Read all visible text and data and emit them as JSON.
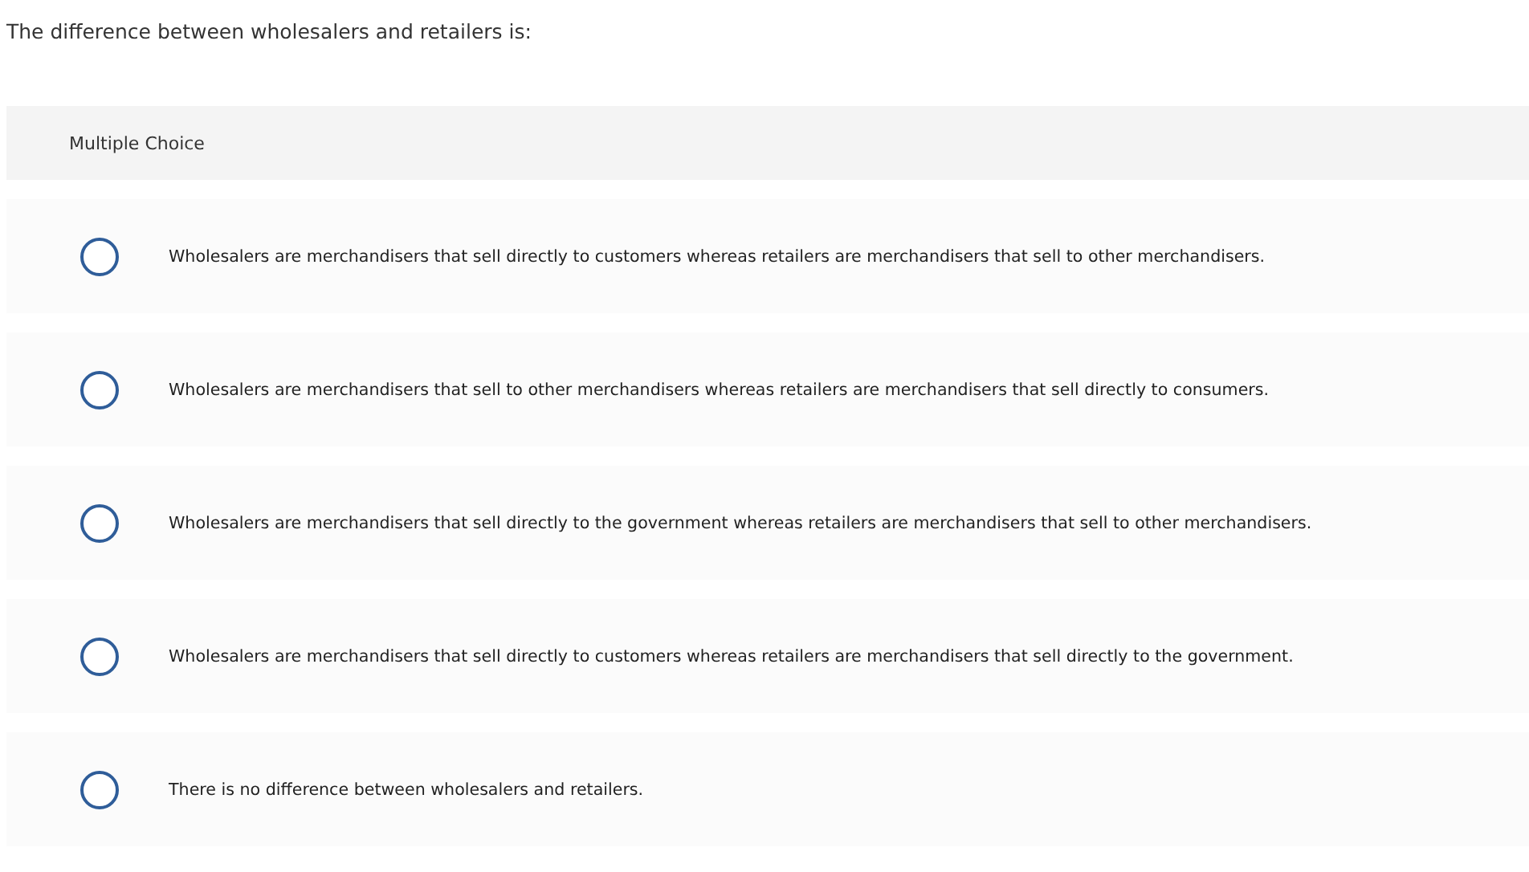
{
  "question": "The difference between wholesalers and retailers is:",
  "panel": {
    "header": "Multiple Choice"
  },
  "options": [
    {
      "label": "Wholesalers are merchandisers that sell directly to customers whereas retailers are merchandisers that sell to other merchandisers.",
      "selected": false
    },
    {
      "label": "Wholesalers are merchandisers that sell to other merchandisers whereas retailers are merchandisers that sell directly to consumers.",
      "selected": false
    },
    {
      "label": "Wholesalers are merchandisers that sell directly to the government whereas retailers are merchandisers that sell to other merchandisers.",
      "selected": false
    },
    {
      "label": "Wholesalers are merchandisers that sell directly to customers whereas retailers are merchandisers that sell directly to the government.",
      "selected": false
    },
    {
      "label": "There is no difference between wholesalers and retailers.",
      "selected": false
    }
  ]
}
